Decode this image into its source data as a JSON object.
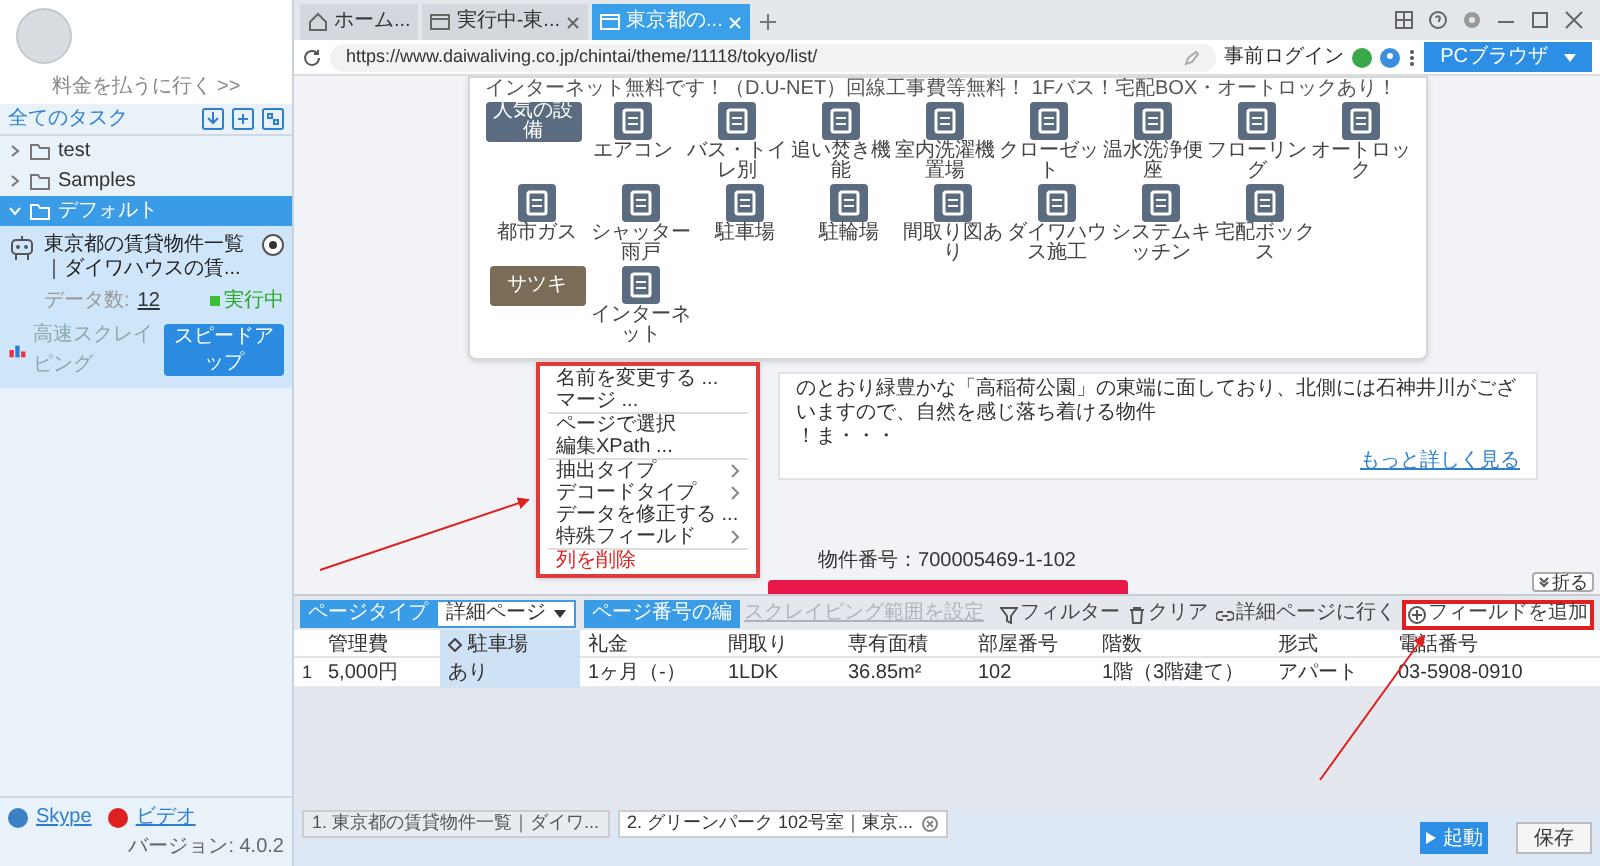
{
  "account": {
    "upgrade_link": "料金を払うに行く >>"
  },
  "sidebar": {
    "title": "全てのタスク",
    "folders": [
      {
        "label": "test",
        "expanded": false,
        "selected": false
      },
      {
        "label": "Samples",
        "expanded": false,
        "selected": false
      },
      {
        "label": "デフォルト",
        "expanded": true,
        "selected": true,
        "tasks": [
          {
            "title": "東京都の賃貸物件一覧｜ダイワハウスの賃...",
            "count_label": "データ数:",
            "count": "12",
            "status": "実行中",
            "mode": "高速スクレイピング",
            "action": "スピードアップ"
          }
        ]
      }
    ],
    "footer": {
      "links": [
        {
          "label": "Skype",
          "color": "#3b7fc4"
        },
        {
          "label": "ビデオ",
          "color": "#e02020"
        }
      ],
      "version": "バージョン: 4.0.2"
    }
  },
  "browser_tabs": [
    {
      "label": "ホーム...",
      "kind": "home",
      "selected": false,
      "closable": false
    },
    {
      "label": "実行中-東...",
      "kind": "page",
      "selected": false,
      "closable": true
    },
    {
      "label": "東京都の...",
      "kind": "page",
      "selected": true,
      "closable": true
    }
  ],
  "address_bar": {
    "url": "https://www.daiwaliving.co.jp/chintai/theme/11118/tokyo/list/",
    "login": "事前ログイン",
    "mode": "PCブラウザ"
  },
  "page": {
    "intro": "インターネット無料です！（D.U-NET）回線工事費等無料！ 1Fバス！宅配BOX・オートロックあり！",
    "facility_rows": [
      [
        {
          "label": "人気の設備",
          "kind": "badge",
          "color": "#5b6b80"
        },
        {
          "label": "エアコン",
          "kind": "icon"
        },
        {
          "label": "バス・トイレ別",
          "kind": "icon"
        },
        {
          "label": "追い焚き機能",
          "kind": "icon"
        },
        {
          "label": "室内洗濯機置場",
          "kind": "icon"
        },
        {
          "label": "クローゼット",
          "kind": "icon"
        },
        {
          "label": "温水洗浄便座",
          "kind": "icon"
        },
        {
          "label": "フローリング",
          "kind": "icon"
        },
        {
          "label": "オートロック",
          "kind": "icon"
        }
      ],
      [
        {
          "label": "都市ガス",
          "kind": "icon"
        },
        {
          "label": "シャッター雨戸",
          "kind": "icon"
        },
        {
          "label": "駐車場",
          "kind": "icon"
        },
        {
          "label": "駐輪場",
          "kind": "icon"
        },
        {
          "label": "間取り図あり",
          "kind": "icon"
        },
        {
          "label": "ダイワハウス施工",
          "kind": "icon"
        },
        {
          "label": "システムキッチン",
          "kind": "icon"
        },
        {
          "label": "宅配ボックス",
          "kind": "icon"
        }
      ],
      [
        {
          "label": "サツキ",
          "kind": "badge",
          "color": "#7a6c57"
        },
        {
          "label": "インターネット",
          "kind": "icon"
        }
      ]
    ],
    "description": [
      "のとおり緑豊かな「高稲荷公園」の東端に面しており、北側には石神井川がございますので、自然を感じ落ち着ける物件",
      "！ま・・・"
    ],
    "more_link": "もっと詳しく見る",
    "property_number": "物件番号：700005469-1-102"
  },
  "context_menu": {
    "groups": [
      [
        {
          "label": "名前を変更する ...",
          "submenu": false,
          "kind": "normal"
        },
        {
          "label": "マージ ...",
          "submenu": false,
          "kind": "normal"
        }
      ],
      [
        {
          "label": "ページで選択",
          "submenu": false,
          "kind": "normal"
        },
        {
          "label": "編集XPath ...",
          "submenu": false,
          "kind": "normal"
        }
      ],
      [
        {
          "label": "抽出タイプ",
          "submenu": true,
          "kind": "normal"
        },
        {
          "label": "デコードタイプ",
          "submenu": true,
          "kind": "normal"
        },
        {
          "label": "データを修正する ...",
          "submenu": false,
          "kind": "normal"
        },
        {
          "label": "特殊フィールド",
          "submenu": true,
          "kind": "normal"
        }
      ],
      [
        {
          "label": "列を削除",
          "submenu": false,
          "kind": "danger"
        }
      ]
    ]
  },
  "collapse_button": "折る",
  "panel": {
    "page_type_label": "ページタイプ",
    "page_type": "詳細ページ",
    "page_number_button": "ページ番号の編",
    "range_button": {
      "label": "スクレイピング範囲を設定",
      "disabled": true
    },
    "actions": [
      {
        "label": "フィルター",
        "kind": "filter",
        "highlighted": false
      },
      {
        "label": "クリア",
        "kind": "clear",
        "highlighted": false
      },
      {
        "label": "詳細ページに行く",
        "kind": "link",
        "highlighted": false
      },
      {
        "label": "フィールドを追加",
        "kind": "add",
        "highlighted": true
      }
    ],
    "table": {
      "columns": [
        {
          "label": "管理費",
          "selected": false
        },
        {
          "label": "駐車場",
          "selected": true
        },
        {
          "label": "礼金",
          "selected": false
        },
        {
          "label": "間取り",
          "selected": false
        },
        {
          "label": "専有面積",
          "selected": false
        },
        {
          "label": "部屋番号",
          "selected": false
        },
        {
          "label": "階数",
          "selected": false
        },
        {
          "label": "形式",
          "selected": false
        },
        {
          "label": "電話番号",
          "selected": false
        }
      ],
      "rows": [
        {
          "index": "1",
          "cells": [
            "5,000円",
            "あり",
            "1ヶ月（-）",
            "1LDK",
            "36.85m²",
            "102",
            "1階（3階建て）",
            "アパート",
            "03-5908-0910"
          ]
        }
      ]
    }
  },
  "bottom_tabs": [
    {
      "label": "1. 東京都の賃貸物件一覧｜ダイワ...",
      "selected": false
    },
    {
      "label": "2. グリーンパーク 102号室｜東京...",
      "selected": true
    }
  ],
  "run_button": "起動",
  "save_button": "保存"
}
